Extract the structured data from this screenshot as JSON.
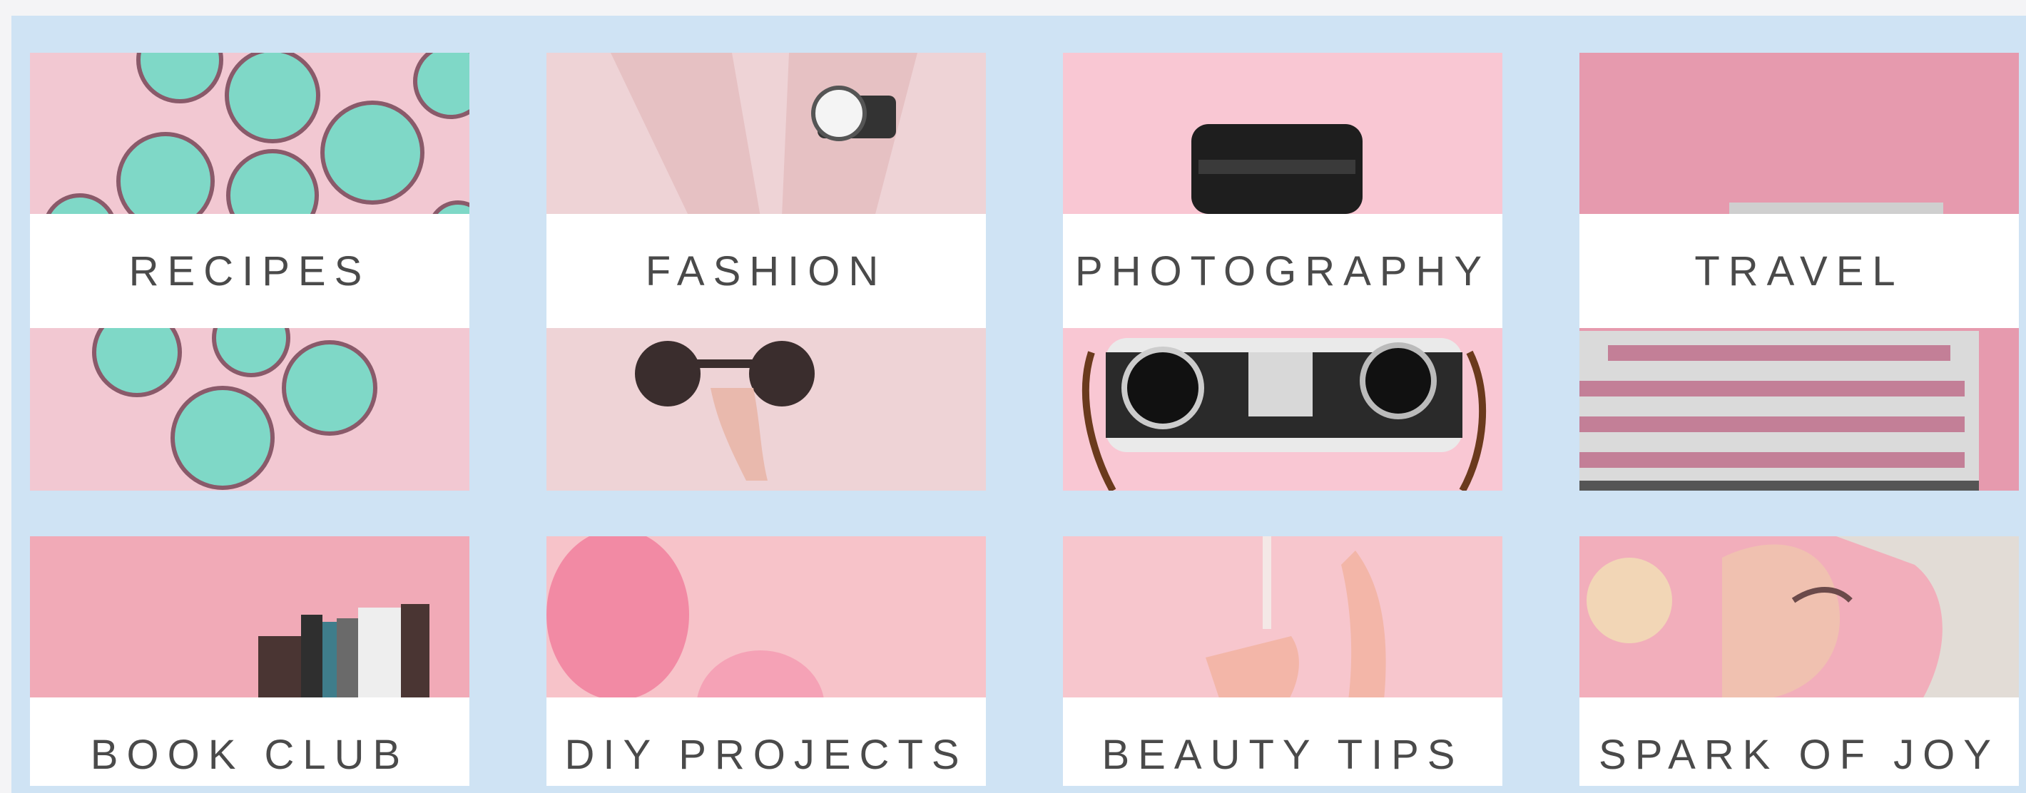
{
  "categories": [
    {
      "label": "RECIPES"
    },
    {
      "label": "FASHION"
    },
    {
      "label": "PHOTOGRAPHY"
    },
    {
      "label": "TRAVEL"
    },
    {
      "label": "BOOK CLUB"
    },
    {
      "label": "DIY PROJECTS"
    },
    {
      "label": "BEAUTY TIPS"
    },
    {
      "label": "SPARK OF JOY"
    }
  ],
  "colors": {
    "panel_background": "#cfe3f4",
    "label_band": "#ffffff",
    "label_text": "#4a4a4a",
    "accent_pink": "#f7c9d3"
  }
}
